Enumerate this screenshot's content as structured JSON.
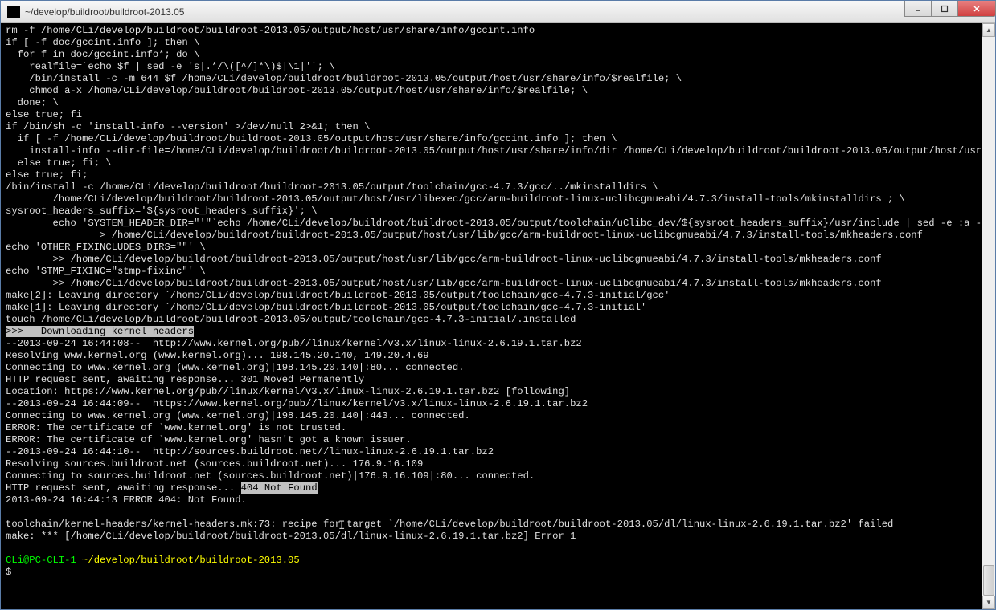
{
  "window": {
    "title": "~/develop/buildroot/buildroot-2013.05"
  },
  "terminal": {
    "lines_before_hl1": "rm -f /home/CLi/develop/buildroot/buildroot-2013.05/output/host/usr/share/info/gccint.info\nif [ -f doc/gccint.info ]; then \\\n  for f in doc/gccint.info*; do \\\n    realfile=`echo $f | sed -e 's|.*/\\([^/]*\\)$|\\1|'`; \\\n    /bin/install -c -m 644 $f /home/CLi/develop/buildroot/buildroot-2013.05/output/host/usr/share/info/$realfile; \\\n    chmod a-x /home/CLi/develop/buildroot/buildroot-2013.05/output/host/usr/share/info/$realfile; \\\n  done; \\\nelse true; fi\nif /bin/sh -c 'install-info --version' >/dev/null 2>&1; then \\\n  if [ -f /home/CLi/develop/buildroot/buildroot-2013.05/output/host/usr/share/info/gccint.info ]; then \\\n    install-info --dir-file=/home/CLi/develop/buildroot/buildroot-2013.05/output/host/usr/share/info/dir /home/CLi/develop/buildroot/buildroot-2013.05/output/host/usr/share/info/gccint.info; \\\n  else true; fi; \\\nelse true; fi;\n/bin/install -c /home/CLi/develop/buildroot/buildroot-2013.05/output/toolchain/gcc-4.7.3/gcc/../mkinstalldirs \\\n        /home/CLi/develop/buildroot/buildroot-2013.05/output/host/usr/libexec/gcc/arm-buildroot-linux-uclibcgnueabi/4.7.3/install-tools/mkinstalldirs ; \\\nsysroot_headers_suffix='${sysroot_headers_suffix}'; \\\n        echo 'SYSTEM_HEADER_DIR=\"'\"`echo /home/CLi/develop/buildroot/buildroot-2013.05/output/toolchain/uClibc_dev/${sysroot_headers_suffix}/usr/include | sed -e :a -e 's,[^/]*/\\.\\.\\/,,' -e ta`\"'\"' \\\n                > /home/CLi/develop/buildroot/buildroot-2013.05/output/host/usr/lib/gcc/arm-buildroot-linux-uclibcgnueabi/4.7.3/install-tools/mkheaders.conf\necho 'OTHER_FIXINCLUDES_DIRS=\"\"' \\\n        >> /home/CLi/develop/buildroot/buildroot-2013.05/output/host/usr/lib/gcc/arm-buildroot-linux-uclibcgnueabi/4.7.3/install-tools/mkheaders.conf\necho 'STMP_FIXINC=\"stmp-fixinc\"' \\\n        >> /home/CLi/develop/buildroot/buildroot-2013.05/output/host/usr/lib/gcc/arm-buildroot-linux-uclibcgnueabi/4.7.3/install-tools/mkheaders.conf\nmake[2]: Leaving directory `/home/CLi/develop/buildroot/buildroot-2013.05/output/toolchain/gcc-4.7.3-initial/gcc'\nmake[1]: Leaving directory `/home/CLi/develop/buildroot/buildroot-2013.05/output/toolchain/gcc-4.7.3-initial'\ntouch /home/CLi/develop/buildroot/buildroot-2013.05/output/toolchain/gcc-4.7.3-initial/.installed",
    "hl1": ">>>   Downloading kernel headers",
    "lines_mid": "--2013-09-24 16:44:08--  http://www.kernel.org/pub//linux/kernel/v3.x/linux-linux-2.6.19.1.tar.bz2\nResolving www.kernel.org (www.kernel.org)... 198.145.20.140, 149.20.4.69\nConnecting to www.kernel.org (www.kernel.org)|198.145.20.140|:80... connected.\nHTTP request sent, awaiting response... 301 Moved Permanently\nLocation: https://www.kernel.org/pub//linux/kernel/v3.x/linux-linux-2.6.19.1.tar.bz2 [following]\n--2013-09-24 16:44:09--  https://www.kernel.org/pub//linux/kernel/v3.x/linux-linux-2.6.19.1.tar.bz2\nConnecting to www.kernel.org (www.kernel.org)|198.145.20.140|:443... connected.\nERROR: The certificate of `www.kernel.org' is not trusted.\nERROR: The certificate of `www.kernel.org' hasn't got a known issuer.\n--2013-09-24 16:44:10--  http://sources.buildroot.net//linux-linux-2.6.19.1.tar.bz2\nResolving sources.buildroot.net (sources.buildroot.net)... 176.9.16.109\nConnecting to sources.buildroot.net (sources.buildroot.net)|176.9.16.109|:80... connected.",
    "line_before_hl2": "HTTP request sent, awaiting response... ",
    "hl2": "404 Not Found",
    "lines_after": "2013-09-24 16:44:13 ERROR 404: Not Found.\n\ntoolchain/kernel-headers/kernel-headers.mk:73: recipe for target `/home/CLi/develop/buildroot/buildroot-2013.05/dl/linux-linux-2.6.19.1.tar.bz2' failed\nmake: *** [/home/CLi/develop/buildroot/buildroot-2013.05/dl/linux-linux-2.6.19.1.tar.bz2] Error 1\n",
    "prompt_user": "CLi@PC-CLI-1 ",
    "prompt_path": "~/develop/buildroot/buildroot-2013.05",
    "prompt_char": "$"
  }
}
